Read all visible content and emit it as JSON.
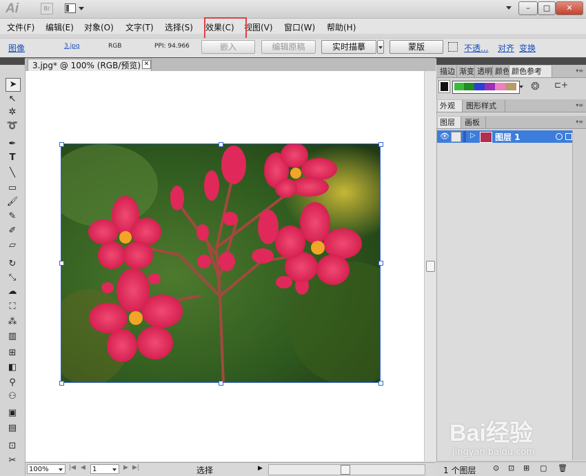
{
  "app": {
    "logo": "Ai",
    "bridge_label": "Br"
  },
  "window_buttons": {
    "minimize": "–",
    "restore": "□",
    "close": "✕"
  },
  "menubar": {
    "items": [
      {
        "label": "文件(F)"
      },
      {
        "label": "编辑(E)"
      },
      {
        "label": "对象(O)"
      },
      {
        "label": "文字(T)"
      },
      {
        "label": "选择(S)"
      },
      {
        "label": "效果(C)"
      },
      {
        "label": "视图(V)"
      },
      {
        "label": "窗口(W)"
      },
      {
        "label": "帮助(H)"
      }
    ],
    "highlighted_item": "效果(C)"
  },
  "control_bar": {
    "object_type": "图像",
    "file_name": "3.jpg",
    "color_mode": "RGB",
    "ppi": "PPI: 94.966",
    "embed_button": "嵌入",
    "edit_original_button": "编辑原稿",
    "live_trace_button": "实时描摹",
    "mask_button": "蒙版",
    "opacity_link": "不透...",
    "align_link": "对齐",
    "transform_link": "变换"
  },
  "document": {
    "tab_title": "3.jpg* @ 100% (RGB/预览)",
    "tab_close": "✕"
  },
  "status_bar": {
    "zoom": "100%",
    "artboard_number": "1",
    "status_text": "选择"
  },
  "panels": {
    "top_tabs": [
      "描边",
      "渐变",
      "透明",
      "颜色",
      "颜色参考"
    ],
    "active_top_tab": "颜色参考",
    "appearance_tabs": [
      "外观",
      "图形样式"
    ],
    "layer_tabs": [
      "图层",
      "画板"
    ],
    "layer_name": "图层 1",
    "layer_count": "1 个图层",
    "guide_swatches": [
      "#3bbd3b",
      "#1f8f1f",
      "#2a3fd6",
      "#9b2fb5",
      "#ee7fbf",
      "#b99a6a"
    ]
  },
  "watermark": {
    "brand": "Bai经验",
    "url": "jingyan.baidu.com"
  },
  "colors": {
    "accent": "#3d7ddb",
    "highlight_box": "#e04040",
    "link": "#1a4fb8"
  }
}
